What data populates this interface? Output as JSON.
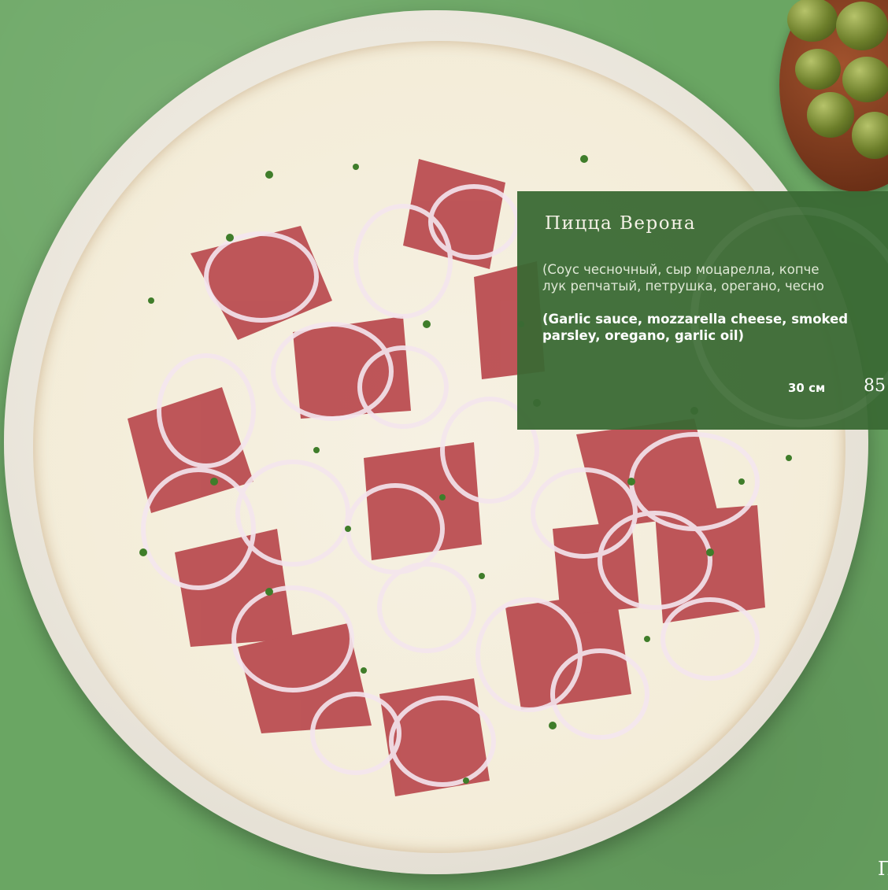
{
  "product": {
    "title": "Пицца Верона",
    "description_ru": "(Соус чесночный, сыр моцарелла, копче\nлук репчатый, петрушка, орегано, чесно",
    "description_en": "(Garlic sauce, mozzarella cheese, smoked\nparsley, oregano, garlic oil)",
    "size": "30 см",
    "price": "85"
  },
  "corner_text": "П",
  "colors": {
    "panel": "#3a6934",
    "background": "#6aa663"
  }
}
